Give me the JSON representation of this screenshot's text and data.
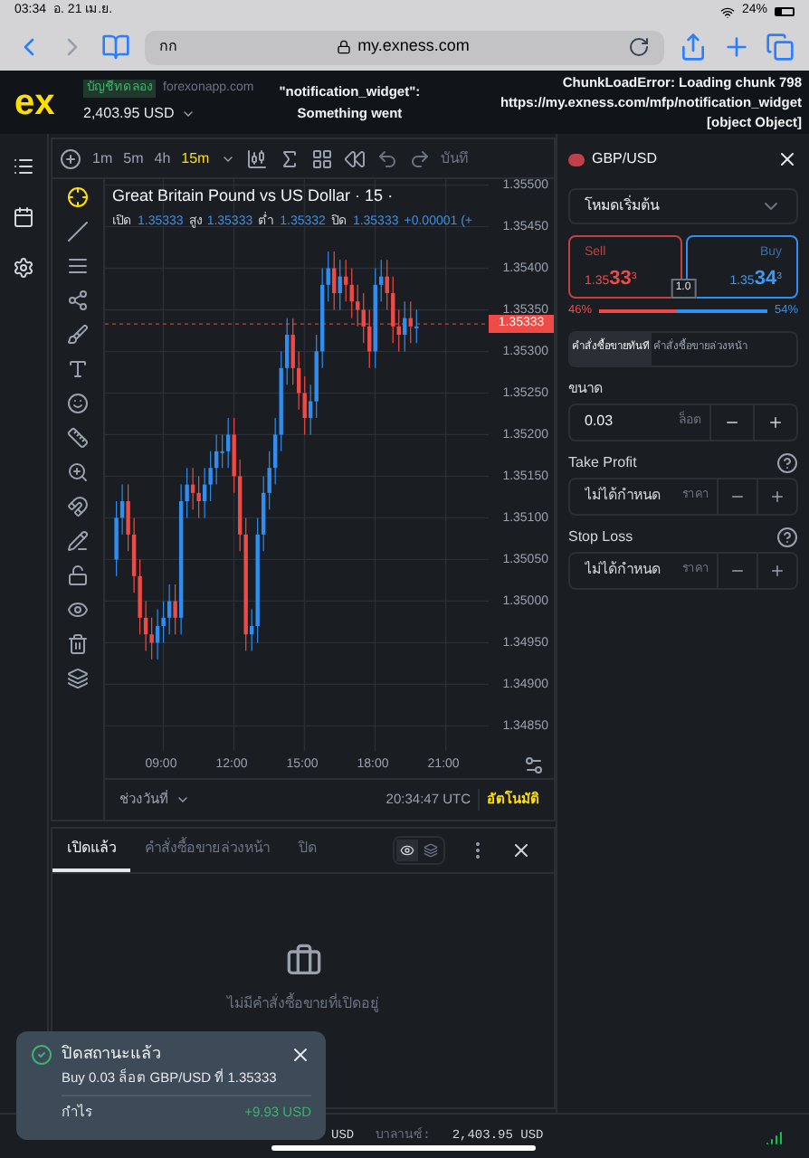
{
  "device_status": {
    "time": "03:34",
    "date": "อ. 21 เม.ย.",
    "battery": "24%"
  },
  "browser": {
    "reader_label": "กก",
    "url": "my.exness.com"
  },
  "header": {
    "logo": "ex",
    "account_badge": "บัญชีทดลอง",
    "account_domain": "forexonapp.com",
    "balance": "2,403.95 USD",
    "error_center": [
      "\"notification_widget\":",
      "Something went"
    ],
    "error_right": [
      "ChunkLoadError: Loading chunk 798",
      "https://my.exness.com/mfp/notification_widget",
      "[object Object]"
    ]
  },
  "timeframes": [
    {
      "label": "1m",
      "selected": false
    },
    {
      "label": "5m",
      "selected": false
    },
    {
      "label": "4h",
      "selected": false
    },
    {
      "label": "15m",
      "selected": true
    }
  ],
  "toolbar_save": "บันทึ",
  "chart": {
    "title": "Great Britain Pound vs US Dollar · 15 ·",
    "ohlc": [
      {
        "label": "เปิด",
        "value": "1.35333"
      },
      {
        "label": "สูง",
        "value": "1.35333"
      },
      {
        "label": "ต่ำ",
        "value": "1.35332"
      },
      {
        "label": "ปิด",
        "value": "1.35333"
      }
    ],
    "change": "+0.00001 (+",
    "chart_data": {
      "type": "candlestick",
      "xlim": [
        6.6,
        22.9
      ],
      "ylim": [
        1.3482,
        1.35507
      ],
      "grid": true,
      "ref_lines": [
        {
          "axis": "y",
          "value": 1.35333,
          "color": "#ef4a45"
        }
      ],
      "x": [
        7,
        7.25,
        7.5,
        7.75,
        8,
        8.25,
        8.5,
        8.75,
        9,
        9.25,
        9.5,
        9.75,
        10,
        10.25,
        10.5,
        10.75,
        11,
        11.25,
        11.5,
        11.75,
        12,
        12.25,
        12.5,
        12.75,
        13,
        13.25,
        13.5,
        13.75,
        14,
        14.25,
        14.5,
        14.75,
        15,
        15.25,
        15.5,
        15.75,
        16,
        16.25,
        16.5,
        16.75,
        17,
        17.25,
        17.5,
        17.75,
        18,
        18.25,
        18.5,
        18.75,
        19,
        19.25,
        19.5,
        19.75
      ],
      "ohlc": [
        [
          1.3505,
          1.3512,
          1.3503,
          1.351
        ],
        [
          1.351,
          1.3514,
          1.3508,
          1.3512
        ],
        [
          1.3512,
          1.3514,
          1.3506,
          1.3508
        ],
        [
          1.3508,
          1.351,
          1.3501,
          1.3503
        ],
        [
          1.3503,
          1.3505,
          1.3496,
          1.3498
        ],
        [
          1.3498,
          1.35,
          1.3494,
          1.3496
        ],
        [
          1.3496,
          1.3498,
          1.3493,
          1.3495
        ],
        [
          1.3495,
          1.3499,
          1.3493,
          1.3497
        ],
        [
          1.3497,
          1.35,
          1.3495,
          1.3498
        ],
        [
          1.3498,
          1.3502,
          1.3496,
          1.35
        ],
        [
          1.35,
          1.3502,
          1.3496,
          1.3498
        ],
        [
          1.3498,
          1.3514,
          1.3496,
          1.3512
        ],
        [
          1.3512,
          1.3516,
          1.351,
          1.3514
        ],
        [
          1.3514,
          1.3516,
          1.3511,
          1.3513
        ],
        [
          1.3513,
          1.3515,
          1.351,
          1.3512
        ],
        [
          1.3512,
          1.3516,
          1.351,
          1.3514
        ],
        [
          1.3514,
          1.3518,
          1.3512,
          1.3516
        ],
        [
          1.3516,
          1.352,
          1.3514,
          1.3518
        ],
        [
          1.3518,
          1.352,
          1.3516,
          1.3518
        ],
        [
          1.3518,
          1.3522,
          1.3516,
          1.352
        ],
        [
          1.352,
          1.3522,
          1.3513,
          1.3515
        ],
        [
          1.3515,
          1.3517,
          1.3506,
          1.3508
        ],
        [
          1.3508,
          1.351,
          1.3494,
          1.3496
        ],
        [
          1.3496,
          1.3499,
          1.3494,
          1.3497
        ],
        [
          1.3497,
          1.351,
          1.3495,
          1.3508
        ],
        [
          1.3508,
          1.3515,
          1.3506,
          1.3513
        ],
        [
          1.3513,
          1.3518,
          1.3511,
          1.3516
        ],
        [
          1.3516,
          1.3522,
          1.3514,
          1.352
        ],
        [
          1.352,
          1.353,
          1.3518,
          1.3528
        ],
        [
          1.3528,
          1.3534,
          1.3526,
          1.3532
        ],
        [
          1.3532,
          1.3534,
          1.3526,
          1.3528
        ],
        [
          1.3528,
          1.353,
          1.3523,
          1.3525
        ],
        [
          1.3525,
          1.3527,
          1.352,
          1.3522
        ],
        [
          1.3522,
          1.3526,
          1.352,
          1.3524
        ],
        [
          1.3524,
          1.3532,
          1.3522,
          1.353
        ],
        [
          1.353,
          1.354,
          1.3528,
          1.3538
        ],
        [
          1.3538,
          1.3542,
          1.3536,
          1.354
        ],
        [
          1.354,
          1.3542,
          1.3535,
          1.3537
        ],
        [
          1.3537,
          1.3541,
          1.3535,
          1.3539
        ],
        [
          1.3539,
          1.3541,
          1.3536,
          1.3538
        ],
        [
          1.3538,
          1.354,
          1.3534,
          1.3536
        ],
        [
          1.3536,
          1.3538,
          1.3533,
          1.3535
        ],
        [
          1.3535,
          1.3537,
          1.3531,
          1.3533
        ],
        [
          1.3533,
          1.3535,
          1.3528,
          1.353
        ],
        [
          1.353,
          1.354,
          1.3528,
          1.3538
        ],
        [
          1.3538,
          1.3541,
          1.3536,
          1.3539
        ],
        [
          1.3539,
          1.3541,
          1.3535,
          1.3537
        ],
        [
          1.3537,
          1.3539,
          1.3531,
          1.3533
        ],
        [
          1.3533,
          1.3535,
          1.353,
          1.3532
        ],
        [
          1.3532,
          1.3536,
          1.353,
          1.3534
        ],
        [
          1.3534,
          1.3536,
          1.3531,
          1.3533
        ],
        [
          1.3533,
          1.3535,
          1.3531,
          1.3533
        ]
      ],
      "yticks": [
        {
          "value": 1.355,
          "label": "1.35500"
        },
        {
          "value": 1.3545,
          "label": "1.35450"
        },
        {
          "value": 1.354,
          "label": "1.35400"
        },
        {
          "value": 1.3535,
          "label": "1.35350"
        },
        {
          "value": 1.353,
          "label": "1.35300"
        },
        {
          "value": 1.3525,
          "label": "1.35250"
        },
        {
          "value": 1.352,
          "label": "1.35200"
        },
        {
          "value": 1.3515,
          "label": "1.35150"
        },
        {
          "value": 1.351,
          "label": "1.35100"
        },
        {
          "value": 1.3505,
          "label": "1.35050"
        },
        {
          "value": 1.35,
          "label": "1.35000"
        },
        {
          "value": 1.3495,
          "label": "1.34950"
        },
        {
          "value": 1.349,
          "label": "1.34900"
        },
        {
          "value": 1.3485,
          "label": "1.34850"
        }
      ],
      "xticks": [
        {
          "value": 9,
          "label": "09:00"
        },
        {
          "value": 12,
          "label": "12:00"
        },
        {
          "value": 15,
          "label": "15:00"
        },
        {
          "value": 18,
          "label": "18:00"
        },
        {
          "value": 21,
          "label": "21:00"
        }
      ]
    },
    "current_price": "1.35333",
    "range_label": "ช่วงวันที่",
    "clock": "20:34:47 UTC",
    "auto_label": "อัตโนมัติ"
  },
  "order_panel": {
    "symbol": "GBP/USD",
    "mode": "โหมดเริ่มต้น",
    "sell": {
      "label": "Sell",
      "price_main": "1.35",
      "price_big": "33",
      "price_sup": "3"
    },
    "buy": {
      "label": "Buy",
      "price_main": "1.35",
      "price_big": "34",
      "price_sup": "3"
    },
    "spread": "1.0",
    "sell_pct": "46%",
    "buy_pct": "54%",
    "sentiment": {
      "level": 0.46
    },
    "order_tabs": [
      {
        "label": "คำสั่งซื้อขายทันที",
        "selected": true
      },
      {
        "label": "คำสั่งซื้อขายล่วงหน้า",
        "selected": false
      }
    ],
    "size": {
      "label": "ขนาด",
      "value": "0.03",
      "unit": "ล็อต"
    },
    "stops": [
      {
        "label": "Take Profit",
        "placeholder": "ไม่ได้กำหนด",
        "unit": "ราคา"
      },
      {
        "label": "Stop Loss",
        "placeholder": "ไม่ได้กำหนด",
        "unit": "ราคา"
      }
    ]
  },
  "positions": {
    "tabs": [
      {
        "label": "เปิดแล้ว",
        "selected": true
      },
      {
        "label": "คำสั่งซื้อขายล่วงหน้า",
        "selected": false
      },
      {
        "label": "ปิด",
        "selected": false
      }
    ],
    "view_modes": [
      {
        "selected": true
      },
      {
        "selected": false
      }
    ],
    "empty_text": "ไม่มีคำสั่งซื้อขายที่เปิดอยู่"
  },
  "status_bar": {
    "equity_tail": "USD",
    "balance_label": "บาลานซ์:",
    "balance": "2,403.95 USD"
  },
  "toast": {
    "title": "ปิดสถานะแล้ว",
    "message": "Buy 0.03 ล็อต GBP/USD ที่ 1.35333",
    "profit_label": "กำไร",
    "profit": "+9.93 USD"
  }
}
